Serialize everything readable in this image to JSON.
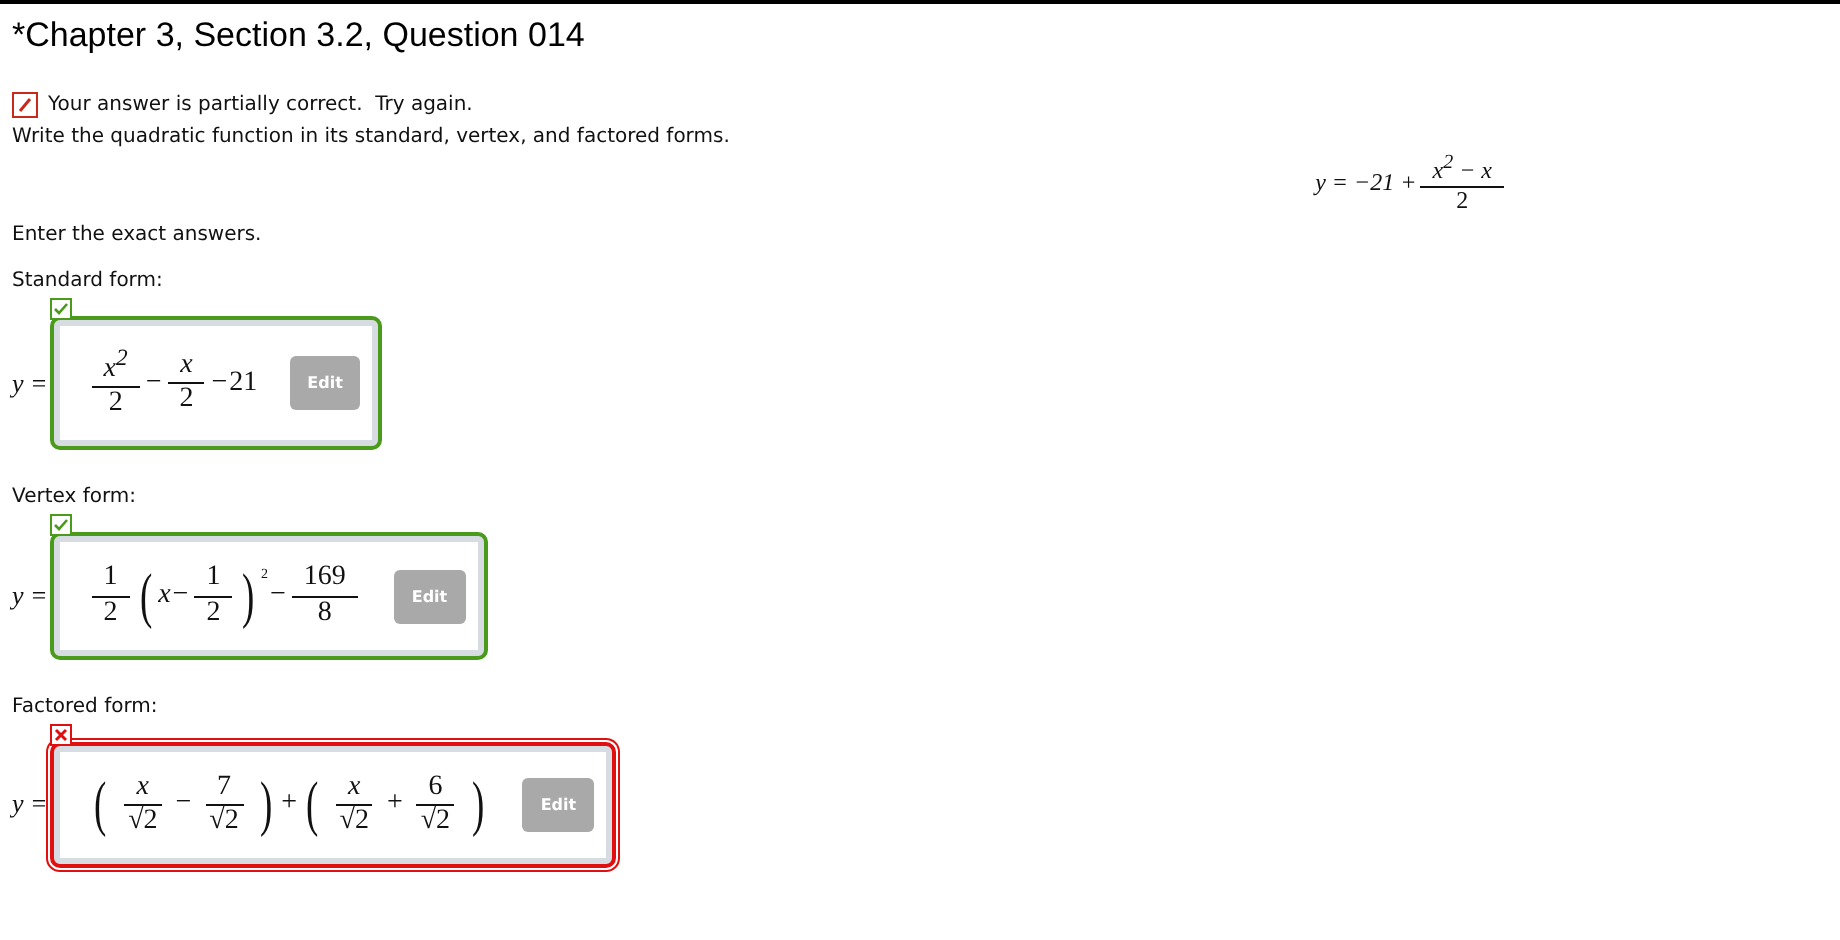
{
  "title": "*Chapter 3, Section 3.2, Question 014",
  "feedback": {
    "partially_correct": true,
    "text": "Your answer is partially correct.  Try again."
  },
  "instruction": "Write the quadratic function in its standard, vertex, and factored forms.",
  "given": {
    "lead": "y = −21 +",
    "terms": [
      {
        "kind": "frac",
        "num": "x$^{2}$ − x",
        "den": "2"
      }
    ]
  },
  "prompt": "Enter the exact answers.",
  "answers": [
    {
      "label": "Standard form:",
      "prefix": "y =",
      "correct": true,
      "button": "Edit",
      "terms": [
        {
          "kind": "frac",
          "num": "x$^{2}$",
          "den": "2"
        },
        {
          "kind": "op",
          "text": "−"
        },
        {
          "kind": "frac",
          "num": "x",
          "den": "2"
        },
        {
          "kind": "op",
          "text": "−"
        },
        {
          "kind": "text",
          "text": "21"
        }
      ]
    },
    {
      "label": "Vertex form:",
      "prefix": "y =",
      "correct": true,
      "button": "Edit",
      "terms": [
        {
          "kind": "frac",
          "num": "1",
          "den": "2"
        },
        {
          "kind": "paren",
          "text": "("
        },
        {
          "kind": "text",
          "text": "x"
        },
        {
          "kind": "op",
          "text": "−"
        },
        {
          "kind": "frac",
          "num": "1",
          "den": "2"
        },
        {
          "kind": "paren",
          "text": ")"
        },
        {
          "kind": "sup",
          "text": "2"
        },
        {
          "kind": "op",
          "text": "−"
        },
        {
          "kind": "frac",
          "num": "169",
          "den": "8"
        }
      ]
    },
    {
      "label": "Factored form:",
      "prefix": "y =",
      "correct": false,
      "button": "Edit",
      "terms": [
        {
          "kind": "paren",
          "text": "("
        },
        {
          "kind": "frac",
          "num": "x",
          "den": "√2"
        },
        {
          "kind": "op",
          "text": "−"
        },
        {
          "kind": "frac",
          "num": "7",
          "den": "√2"
        },
        {
          "kind": "paren",
          "text": ")"
        },
        {
          "kind": "op",
          "text": "+"
        },
        {
          "kind": "paren",
          "text": "("
        },
        {
          "kind": "frac",
          "num": "x",
          "den": "√2"
        },
        {
          "kind": "op",
          "text": "+"
        },
        {
          "kind": "frac",
          "num": "6",
          "den": "√2"
        },
        {
          "kind": "paren",
          "text": ")"
        }
      ]
    }
  ]
}
